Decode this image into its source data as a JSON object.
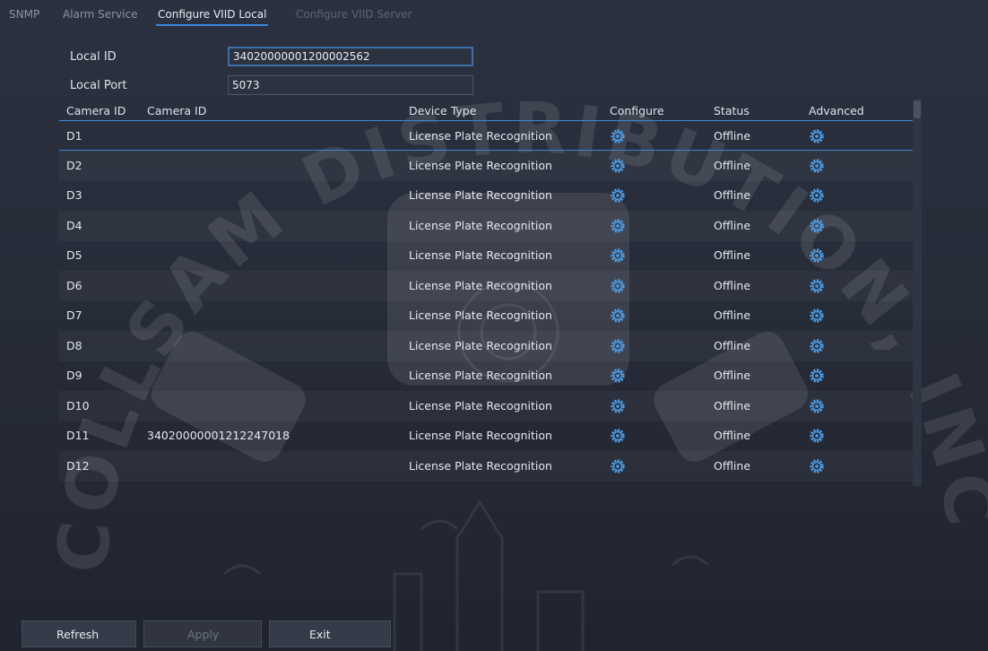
{
  "tabs": [
    {
      "label": "SNMP"
    },
    {
      "label": "Alarm Service"
    },
    {
      "label": "Configure VIID Local"
    },
    {
      "label": "Configure VIID Server"
    }
  ],
  "form": {
    "local_id_label": "Local ID",
    "local_id_value": "34020000001200002562",
    "local_port_label": "Local Port",
    "local_port_value": "5073"
  },
  "table": {
    "headers": [
      "Camera ID",
      "Camera ID",
      "Device Type",
      "Configure",
      "Status",
      "Advanced"
    ],
    "rows": [
      {
        "channel": "D1",
        "camera_id": "",
        "device_type": "License Plate Recognition",
        "status": "Offline"
      },
      {
        "channel": "D2",
        "camera_id": "",
        "device_type": "License Plate Recognition",
        "status": "Offline"
      },
      {
        "channel": "D3",
        "camera_id": "",
        "device_type": "License Plate Recognition",
        "status": "Offline"
      },
      {
        "channel": "D4",
        "camera_id": "",
        "device_type": "License Plate Recognition",
        "status": "Offline"
      },
      {
        "channel": "D5",
        "camera_id": "",
        "device_type": "License Plate Recognition",
        "status": "Offline"
      },
      {
        "channel": "D6",
        "camera_id": "",
        "device_type": "License Plate Recognition",
        "status": "Offline"
      },
      {
        "channel": "D7",
        "camera_id": "",
        "device_type": "License Plate Recognition",
        "status": "Offline"
      },
      {
        "channel": "D8",
        "camera_id": "",
        "device_type": "License Plate Recognition",
        "status": "Offline"
      },
      {
        "channel": "D9",
        "camera_id": "",
        "device_type": "License Plate Recognition",
        "status": "Offline"
      },
      {
        "channel": "D10",
        "camera_id": "",
        "device_type": "License Plate Recognition",
        "status": "Offline"
      },
      {
        "channel": "D11",
        "camera_id": "34020000001212247018",
        "device_type": "License Plate Recognition",
        "status": "Offline"
      },
      {
        "channel": "D12",
        "camera_id": "",
        "device_type": "License Plate Recognition",
        "status": "Offline"
      }
    ],
    "configure_icon": "gear-icon",
    "advanced_icon": "gear-icon"
  },
  "buttons": {
    "refresh": "Refresh",
    "apply": "Apply",
    "exit": "Exit"
  },
  "watermark": "COLLSAM DISTRIBUTION, INC",
  "colors": {
    "accent": "#3b86d8",
    "gear": "#4e9ee8",
    "background": "#242a37"
  }
}
